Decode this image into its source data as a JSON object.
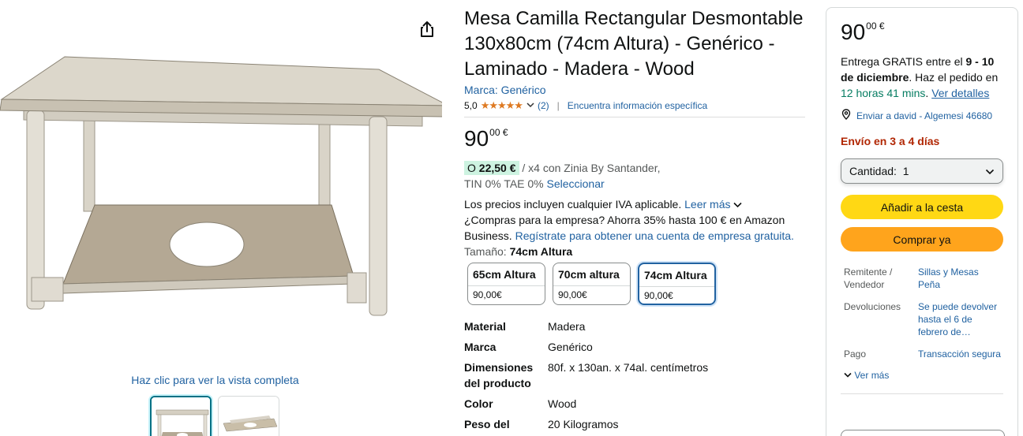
{
  "icons": {
    "share": "share-icon",
    "location": "location-pin-icon",
    "star": "star-icon",
    "chevron": "chevron-down-icon"
  },
  "colors": {
    "link": "#2162a1",
    "star": "#de7921",
    "add_to_cart": "#ffd814",
    "buy_now": "#ffa41c",
    "ship_warning": "#b12704",
    "green": "#067d62"
  },
  "gallery": {
    "view_full": "Haz clic para ver la vista completa"
  },
  "product": {
    "title": "Mesa Camilla Rectangular Desmontable 130x80cm (74cm Altura) - Genérico - Laminado - Madera - Wood",
    "brand_link": "Marca: Genérico",
    "rating_value": "5,0",
    "stars": "★★★★★",
    "review_count": "(2)",
    "find_info": "Encuentra información específica",
    "price_whole": "90",
    "price_fraction": "00 €",
    "finance": {
      "prefix": "O",
      "amount": "22,50 €",
      "text": " / x4 con Zinia By Santander,",
      "line2": "TIN 0% TAE 0%",
      "select": "Seleccionar"
    },
    "vat_text": "Los precios incluyen cualquier IVA aplicable.",
    "read_more": "Leer más",
    "business_text": "¿Compras para la empresa? Ahorra 35% hasta 100 € en Amazon Business.",
    "business_link": "Regístrate para obtener una cuenta de empresa gratuita.",
    "size_label": "Tamaño:",
    "size_selected": "74cm Altura",
    "sizes": [
      {
        "name": "65cm Altura",
        "price": "90,00€"
      },
      {
        "name": "70cm altura",
        "price": "90,00€"
      },
      {
        "name": "74cm Altura",
        "price": "90,00€"
      }
    ],
    "specs": [
      {
        "key": "Material",
        "value": "Madera"
      },
      {
        "key": "Marca",
        "value": "Genérico"
      },
      {
        "key": "Dimensiones del producto",
        "value": "80f. x 130an. x 74al. centímetros"
      },
      {
        "key": "Color",
        "value": "Wood"
      },
      {
        "key": "Peso del",
        "value": "20 Kilogramos"
      }
    ]
  },
  "buybox": {
    "price_whole": "90",
    "price_fraction": "00 €",
    "delivery_prefix": "Entrega GRATIS entre el ",
    "delivery_dates": "9 - 10 de diciembre",
    "delivery_mid": ". Haz el pedido en ",
    "delivery_time": "12 horas 41 mins",
    "delivery_dot": ". ",
    "delivery_details": "Ver detalles",
    "deliver_to": "Enviar a david - Algemesi 46680",
    "ship_time": "Envío en 3 a 4 días",
    "qty_label": "Cantidad:",
    "qty_value": "1",
    "add_to_cart": "Añadir a la cesta",
    "buy_now": "Comprar ya",
    "info": [
      {
        "key": "Remitente / Vendedor",
        "value": "Sillas y Mesas Peña"
      },
      {
        "key": "Devoluciones",
        "value": "Se puede devolver hasta el 6 de febrero de…"
      },
      {
        "key": "Pago",
        "value": "Transacción segura"
      }
    ],
    "see_more": "Ver más"
  }
}
